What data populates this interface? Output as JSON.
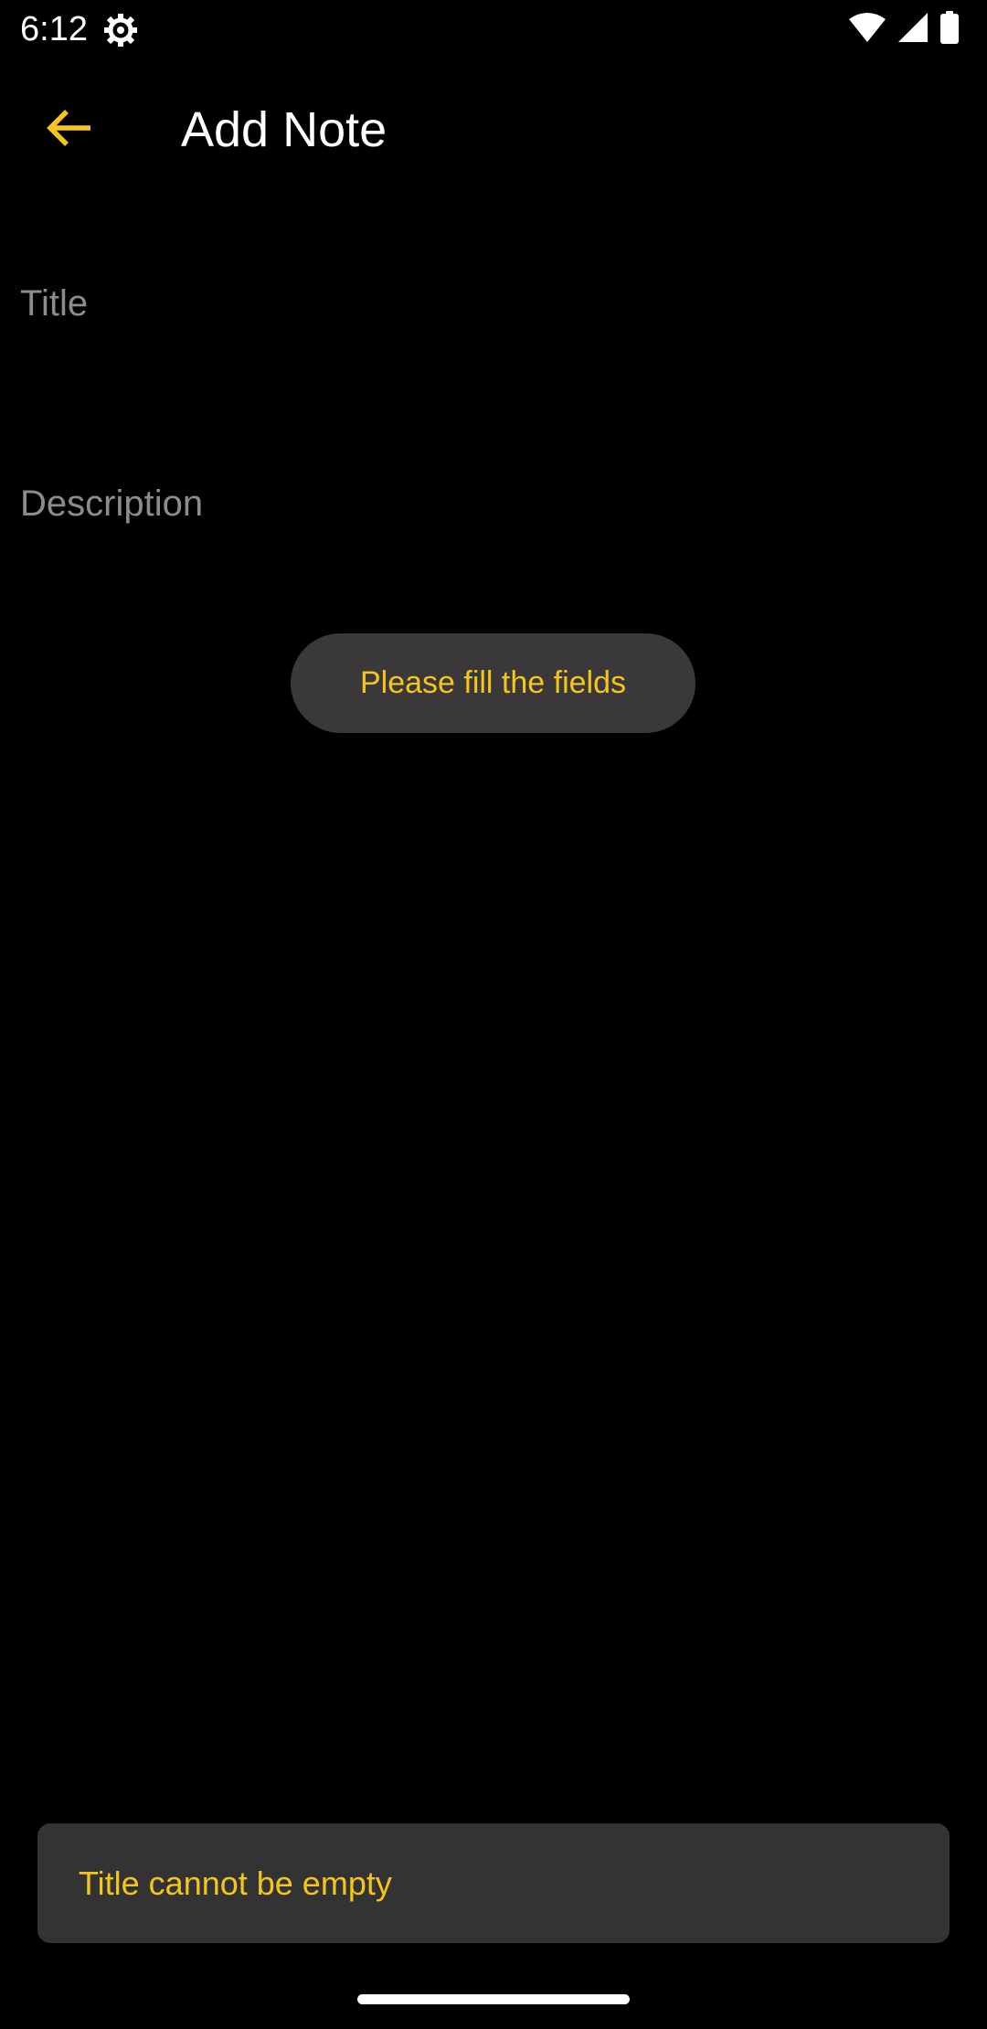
{
  "status_bar": {
    "time": "6:12",
    "icons": [
      "settings-gear-icon",
      "wifi-icon",
      "cellular-signal-icon",
      "battery-icon"
    ]
  },
  "app_bar": {
    "back_icon": "arrow-back-icon",
    "title": "Add Note"
  },
  "form": {
    "title_placeholder": "Title",
    "title_value": "",
    "description_placeholder": "Description",
    "description_value": ""
  },
  "toast": {
    "message": "Please fill the fields"
  },
  "snackbar": {
    "message": "Title cannot be empty"
  },
  "colors": {
    "background": "#000000",
    "accent": "#f5c51b",
    "toast_background": "#3a3838",
    "snackbar_background": "#333333",
    "placeholder": "#8c8c8c"
  }
}
